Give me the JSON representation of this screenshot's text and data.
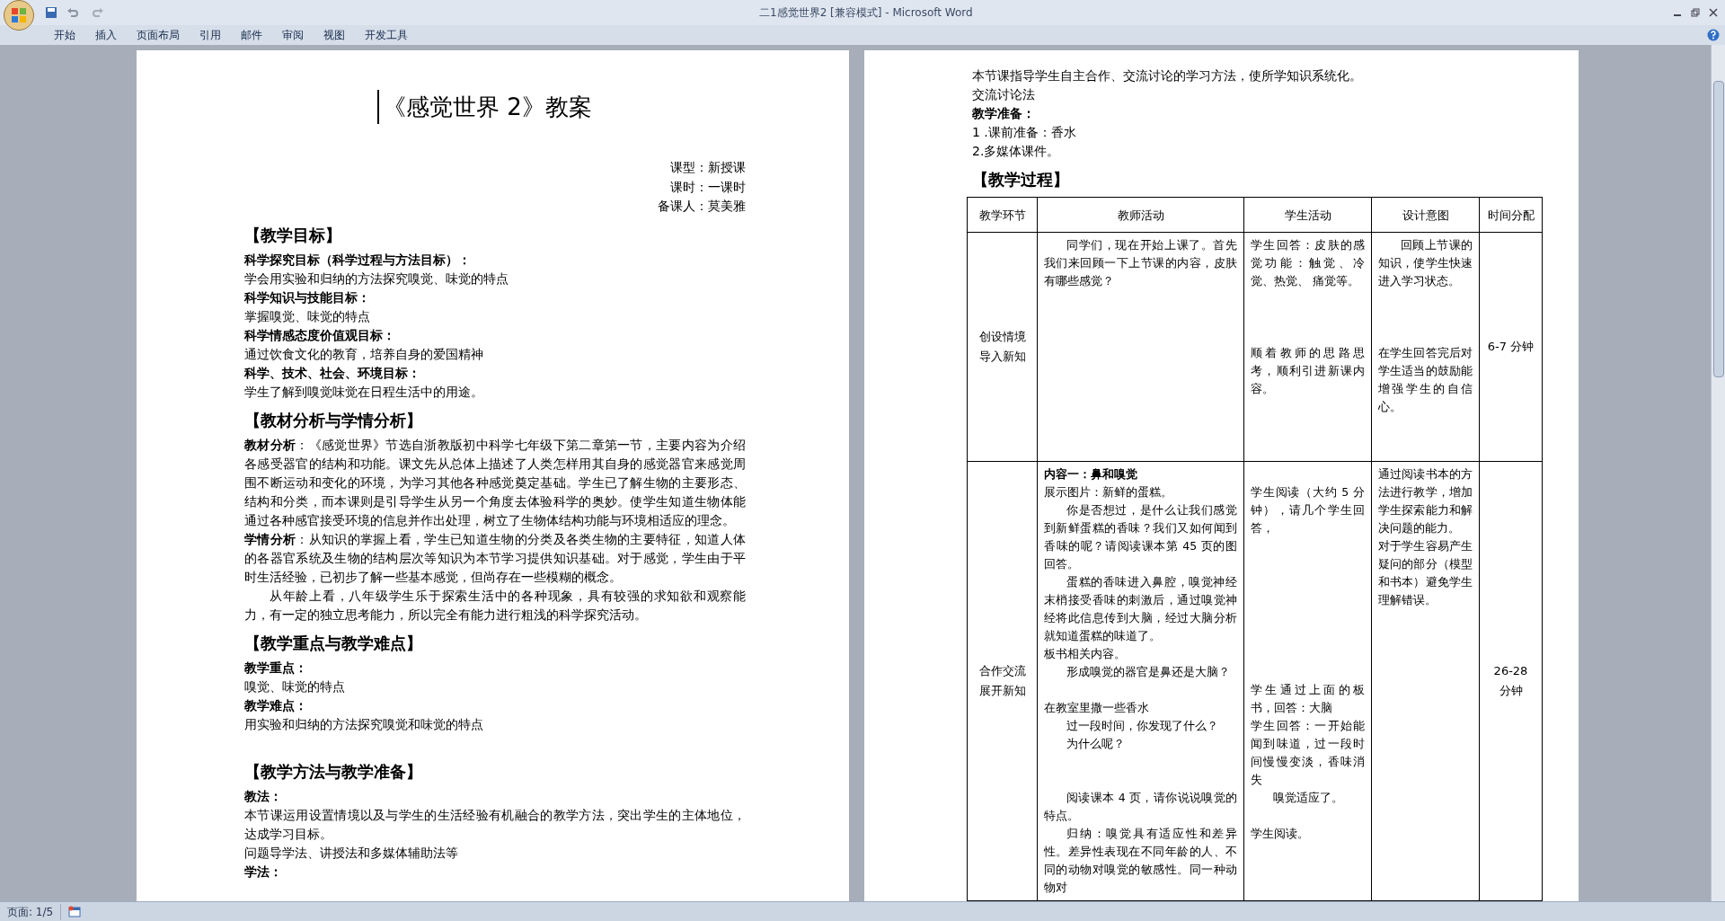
{
  "window": {
    "title": "二1感觉世界2 [兼容模式] - Microsoft Word"
  },
  "ribbon_tabs": [
    "开始",
    "插入",
    "页面布局",
    "引用",
    "邮件",
    "审阅",
    "视图",
    "开发工具"
  ],
  "left_page": {
    "title": "《感觉世界 2》教案",
    "meta": [
      "课型：新授课",
      "课时：一课时",
      "备课人：莫美雅"
    ],
    "blocks": [
      {
        "kind": "heading",
        "text": "【教学目标】"
      },
      {
        "kind": "label",
        "text": "科学探究目标（科学过程与方法目标）："
      },
      {
        "kind": "para",
        "text": "学会用实验和归纳的方法探究嗅觉、味觉的特点"
      },
      {
        "kind": "label",
        "text": "科学知识与技能目标："
      },
      {
        "kind": "para",
        "text": "掌握嗅觉、味觉的特点"
      },
      {
        "kind": "label",
        "text": "科学情感态度价值观目标："
      },
      {
        "kind": "para",
        "text": "通过饮食文化的教育，培养自身的爱国精神"
      },
      {
        "kind": "label",
        "text": "科学、技术、社会、环境目标："
      },
      {
        "kind": "para",
        "text": "学生了解到嗅觉味觉在日程生活中的用途。"
      },
      {
        "kind": "heading",
        "text": "【教材分析与学情分析】"
      },
      {
        "kind": "para",
        "text": "**教材分析**：《感觉世界》节选自浙教版初中科学七年级下第二章第一节，主要内容为介绍各感受器官的结构和功能。课文先从总体上描述了人类怎样用其自身的感觉器官来感觉周围不断运动和变化的环境，为学习其他各种感觉奠定基础。学生已了解生物的主要形态、结构和分类，而本课则是引导学生从另一个角度去体验科学的奥妙。使学生知道生物体能通过各种感官接受环境的信息并作出处理，树立了生物体结构功能与环境相适应的理念。"
      },
      {
        "kind": "para",
        "text": "**学情分析**：从知识的掌握上看，学生已知道生物的分类及各类生物的主要特征，知道人体的各器官系统及生物的结构层次等知识为本节学习提供知识基础。对于感觉，学生由于平时生活经验，已初步了解一些基本感觉，但尚存在一些模糊的概念。"
      },
      {
        "kind": "indent",
        "text": "从年龄上看，八年级学生乐于探索生活中的各种现象，具有较强的求知欲和观察能力，有一定的独立思考能力，所以完全有能力进行粗浅的科学探究活动。"
      },
      {
        "kind": "heading",
        "text": "【教学重点与教学难点】"
      },
      {
        "kind": "label",
        "text": "教学重点："
      },
      {
        "kind": "para",
        "text": "嗅觉、味觉的特点"
      },
      {
        "kind": "label",
        "text": "教学难点："
      },
      {
        "kind": "para",
        "text": "用实验和归纳的方法探究嗅觉和味觉的特点"
      },
      {
        "kind": "blank"
      },
      {
        "kind": "heading",
        "text": "【教学方法与教学准备】"
      },
      {
        "kind": "label",
        "text": "教法："
      },
      {
        "kind": "para",
        "text": "本节课运用设置情境以及与学生的生活经验有机融合的教学方法，突出学生的主体地位，达成学习目标。"
      },
      {
        "kind": "para",
        "text": "问题导学法、讲授法和多媒体辅助法等"
      },
      {
        "kind": "label",
        "text": "学法："
      }
    ]
  },
  "right_page": {
    "blocks": [
      {
        "kind": "para",
        "text": "本节课指导学生自主合作、交流讨论的学习方法，使所学知识系统化。"
      },
      {
        "kind": "para",
        "text": "交流讨论法"
      },
      {
        "kind": "label",
        "text": "教学准备："
      },
      {
        "kind": "para",
        "text": "1 .课前准备：香水"
      },
      {
        "kind": "para",
        "text": "2.多媒体课件。"
      },
      {
        "kind": "heading",
        "text": "【教学过程】"
      }
    ],
    "table": {
      "columns": [
        "教学环节",
        "教师活动",
        "学生活动",
        "设计意图",
        "时间分配"
      ],
      "rows": [
        {
          "stage": [
            "创设情境",
            "导入新知"
          ],
          "teacher": [
            {
              "kind": "indent",
              "text": "同学们，现在开始上课了。首先我们来回顾一下上节课的内容，皮肤有哪些感觉？"
            }
          ],
          "student": [
            {
              "kind": "para",
              "text": "学生回答：皮肤的感觉功能：触觉、冷觉、热觉、 痛觉等。"
            },
            {
              "kind": "blank"
            },
            {
              "kind": "blank"
            },
            {
              "kind": "blank"
            },
            {
              "kind": "para",
              "text": "顺着教师的思路思考，顺利引进新课内容。"
            }
          ],
          "design": [
            {
              "kind": "indent",
              "text": "回顾上节课的知识，使学生快速进入学习状态。"
            },
            {
              "kind": "blank"
            },
            {
              "kind": "blank"
            },
            {
              "kind": "blank"
            },
            {
              "kind": "para",
              "text": "在学生回答完后对学生适当的鼓励能增强学生的自信心。"
            },
            {
              "kind": "blank"
            }
          ],
          "time": [
            "6-7 分钟"
          ]
        },
        {
          "stage": [
            "合作交流",
            "展开新知"
          ],
          "teacher": [
            {
              "kind": "label",
              "text": "内容一：鼻和嗅觉"
            },
            {
              "kind": "para",
              "text": "展示图片：新鲜的蛋糕。"
            },
            {
              "kind": "indent",
              "text": "你是否想过，是什么让我们感觉到新鲜蛋糕的香味？我们又如何闻到香味的呢？请阅读课本第 45 页的图回答。"
            },
            {
              "kind": "indent",
              "text": "蛋糕的香味进入鼻腔，嗅觉神经末梢接受香味的刺激后，通过嗅觉神经将此信息传到大脑，经过大脑分析就知道蛋糕的味道了。"
            },
            {
              "kind": "para",
              "text": "板书相关内容。"
            },
            {
              "kind": "indent",
              "text": "形成嗅觉的器官是鼻还是大脑？"
            },
            {
              "kind": "blank"
            },
            {
              "kind": "para",
              "text": "在教室里撒一些香水"
            },
            {
              "kind": "indent",
              "text": "过一段时间，你发现了什么？"
            },
            {
              "kind": "indent",
              "text": "为什么呢？"
            },
            {
              "kind": "blank"
            },
            {
              "kind": "blank"
            },
            {
              "kind": "indent",
              "text": "阅读课本 4 页，请你说说嗅觉的特点。"
            },
            {
              "kind": "indent",
              "text": "归纳：嗅觉具有适应性和差异性。差异性表现在不同年龄的人、不同的动物对嗅觉的敏感性。同一种动物对"
            }
          ],
          "student": [
            {
              "kind": "blank"
            },
            {
              "kind": "para",
              "text": "学生阅读（大约 5 分钟），请几个学生回答，"
            },
            {
              "kind": "blank"
            },
            {
              "kind": "blank"
            },
            {
              "kind": "blank"
            },
            {
              "kind": "blank"
            },
            {
              "kind": "blank"
            },
            {
              "kind": "blank"
            },
            {
              "kind": "blank"
            },
            {
              "kind": "blank"
            },
            {
              "kind": "para",
              "text": "学生通过上面的板书，回答：大脑"
            },
            {
              "kind": "para",
              "text": "学生回答：一开始能闻到味道，过一段时间慢慢变淡，香味消失"
            },
            {
              "kind": "indent",
              "text": "嗅觉适应了。"
            },
            {
              "kind": "blank"
            },
            {
              "kind": "para",
              "text": "学生阅读。"
            }
          ],
          "design": [
            {
              "kind": "para",
              "text": "通过阅读书本的方法进行教学，增加学生探索能力和解决问题的能力。"
            },
            {
              "kind": "para",
              "text": "对于学生容易产生疑问的部分（模型和书本）避免学生理解错误。"
            },
            {
              "kind": "blank"
            },
            {
              "kind": "blank"
            }
          ],
          "time": [
            "26-28",
            "分钟"
          ]
        }
      ]
    }
  },
  "status_bar": {
    "page": "页面: 1/5"
  }
}
